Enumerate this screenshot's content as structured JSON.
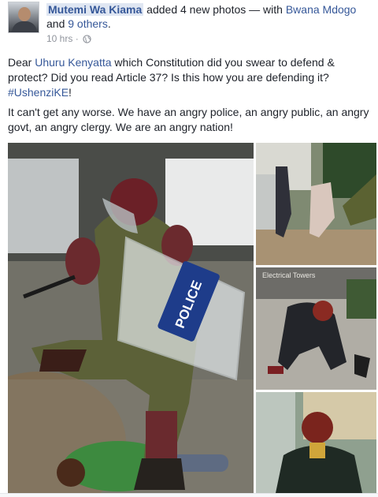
{
  "post": {
    "author": "Mutemi Wa Kiama",
    "action": " added 4 new photos — with ",
    "tagged": "Bwana Mdogo",
    "and": " and ",
    "others": "9 others",
    "period": ".",
    "time": "10 hrs",
    "sep": " · ",
    "p1_a": "Dear ",
    "p1_link1": "Uhuru Kenyatta",
    "p1_b": " which Constitution did you swear to defend & protect? Did you read Article 37? Is this how you are defending it? ",
    "p1_hashtag": "#UshenziKE",
    "p1_c": "!",
    "p2": "It can't get any worse. We have an angry police, an angry public, an angry govt, an angry clergy. We are an angry nation!",
    "photos": [
      {
        "label": "POLICE"
      },
      {
        "label": ""
      },
      {
        "label": "Electrical Towers"
      },
      {
        "label": ""
      }
    ]
  },
  "colors": {
    "link": "#365899",
    "meta": "#90949c",
    "text": "#1d2129"
  },
  "icons": [
    "avatar",
    "globe-icon"
  ]
}
